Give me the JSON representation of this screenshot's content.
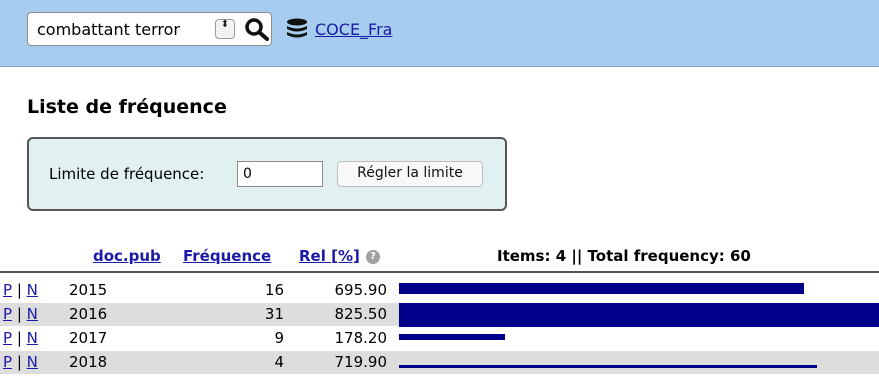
{
  "toolbar": {
    "query_value": "combattant terror",
    "spinner_glyph": "⬍",
    "corpus_name": "COCE_Fra"
  },
  "page": {
    "title": "Liste de fréquence"
  },
  "limit": {
    "label": "Limite de fréquence:",
    "value": "0",
    "button_label": "Régler la limite"
  },
  "table": {
    "columns": {
      "doc": "doc.pub",
      "freq": "Fréquence",
      "rel": "Rel [%]",
      "help": "?"
    },
    "summary": "Items: 4 || Total frequency: 60",
    "link_p": "P",
    "link_sep": "|",
    "link_n": "N",
    "rows": [
      {
        "year": "2015",
        "freq": "16",
        "rel": "695.90"
      },
      {
        "year": "2016",
        "freq": "31",
        "rel": "825.50"
      },
      {
        "year": "2017",
        "freq": "9",
        "rel": "178.20"
      },
      {
        "year": "2018",
        "freq": "4",
        "rel": "719.90"
      }
    ]
  },
  "colors": {
    "topbar": "#a6cdef",
    "bar": "#00008b",
    "link": "#1a1aa6",
    "limit_box": "#e1f1f1"
  }
}
